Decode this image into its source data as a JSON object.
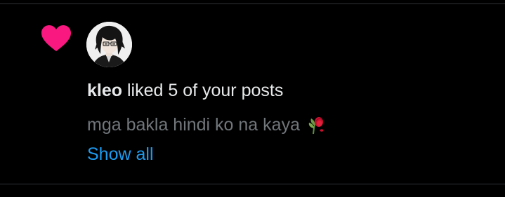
{
  "notification": {
    "icon": "heart-icon",
    "icon_color": "#f91880",
    "avatar": "avatar-anime-dark-hair-glasses",
    "username": "kleo",
    "action_text": "liked 5 of your posts",
    "post_preview": "mga bakla hindi ko na kaya",
    "post_preview_emoji": "wilted-rose-icon",
    "show_all_label": "Show all"
  },
  "colors": {
    "background": "#000000",
    "divider": "#2f3336",
    "primary_text": "#e7e9ea",
    "secondary_text": "#71767b",
    "link": "#1d9bf0"
  }
}
